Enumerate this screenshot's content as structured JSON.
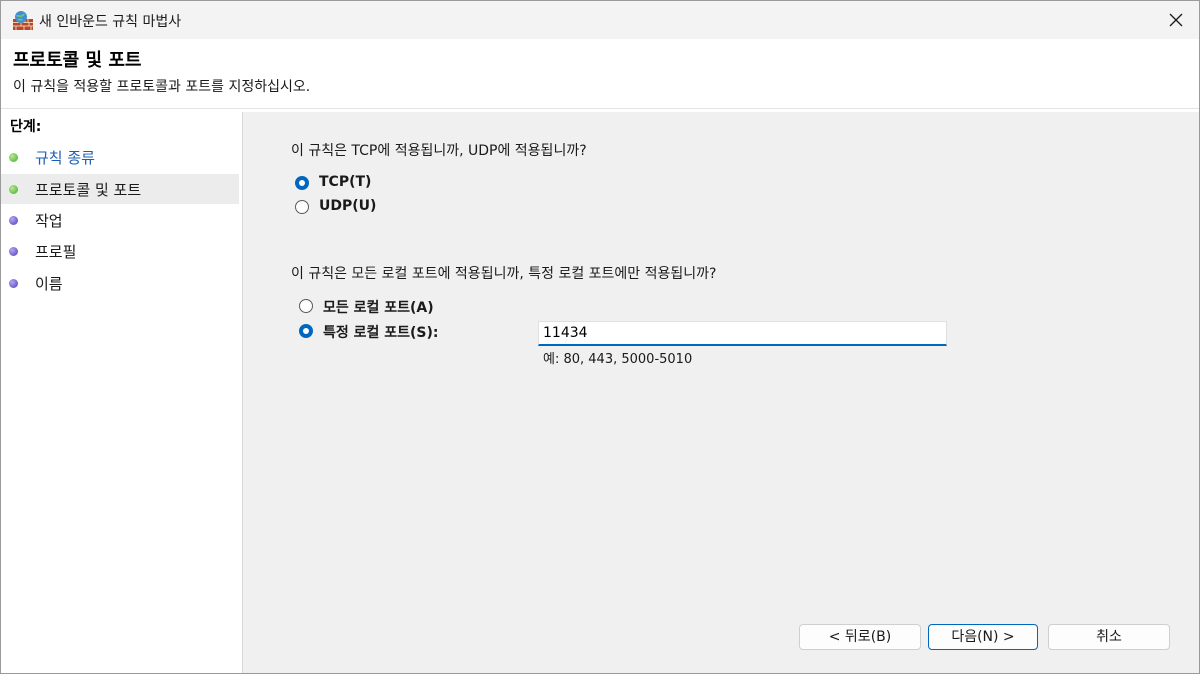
{
  "window": {
    "title": "새 인바운드 규칙 마법사"
  },
  "header": {
    "title": "프로토콜 및 포트",
    "subtitle": "이 규칙을 적용할 프로토콜과 포트를 지정하십시오."
  },
  "sidebar": {
    "steps_label": "단계:",
    "items": [
      {
        "label": "규칙 종류",
        "dot_color": "green",
        "state": "link"
      },
      {
        "label": "프로토콜 및 포트",
        "dot_color": "green",
        "state": "selected"
      },
      {
        "label": "작업",
        "dot_color": "purple",
        "state": "normal"
      },
      {
        "label": "프로필",
        "dot_color": "purple",
        "state": "normal"
      },
      {
        "label": "이름",
        "dot_color": "purple",
        "state": "normal"
      }
    ]
  },
  "protocol": {
    "question": "이 규칙은 TCP에 적용됩니까, UDP에 적용됩니까?",
    "options": [
      {
        "label": "TCP(T)",
        "checked": true
      },
      {
        "label": "UDP(U)",
        "checked": false
      }
    ]
  },
  "ports": {
    "question": "이 규칙은 모든 로컬 포트에 적용됩니까, 특정 로컬 포트에만 적용됩니까?",
    "options": [
      {
        "label": "모든 로컬 포트(A)",
        "checked": false
      },
      {
        "label": "특정 로컬 포트(S):",
        "checked": true
      }
    ],
    "input_value": "11434",
    "hint": "예: 80, 443, 5000-5010"
  },
  "buttons": {
    "back": "< 뒤로(B)",
    "next": "다음(N) >",
    "cancel": "취소"
  },
  "colors": {
    "accent": "#0067c0",
    "link": "#1a5fb4",
    "dot_green": "#44a72d",
    "dot_purple": "#4b3cb8"
  }
}
